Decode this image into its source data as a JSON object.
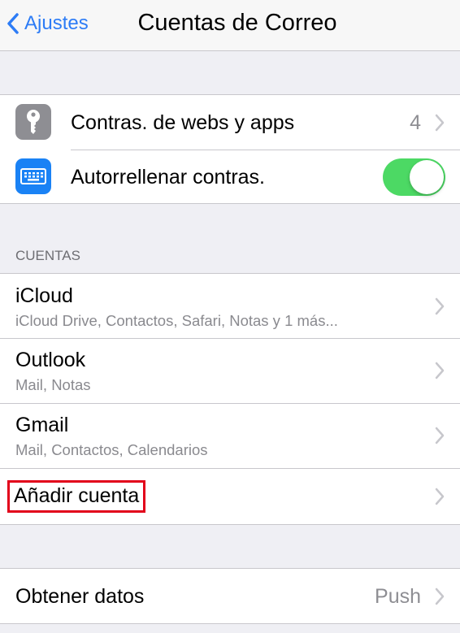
{
  "navbar": {
    "back_label": "Ajustes",
    "title": "Cuentas de Correo"
  },
  "passwords": {
    "webs_apps_label": "Contras. de webs y apps",
    "webs_apps_count": "4",
    "autofill_label": "Autorrellenar contras.",
    "autofill_on": true
  },
  "accounts": {
    "header": "CUENTAS",
    "items": [
      {
        "name": "iCloud",
        "detail": "iCloud Drive, Contactos, Safari, Notas y 1 más..."
      },
      {
        "name": "Outlook",
        "detail": "Mail, Notas"
      },
      {
        "name": "Gmail",
        "detail": "Mail, Contactos, Calendarios"
      }
    ],
    "add_label": "Añadir cuenta"
  },
  "fetch": {
    "label": "Obtener datos",
    "value": "Push"
  },
  "colors": {
    "accent": "#2d7cf6",
    "toggle_on": "#4cd964",
    "highlight": "#e2001a"
  },
  "icons": {
    "key": "key-icon",
    "keyboard": "keyboard-icon"
  }
}
